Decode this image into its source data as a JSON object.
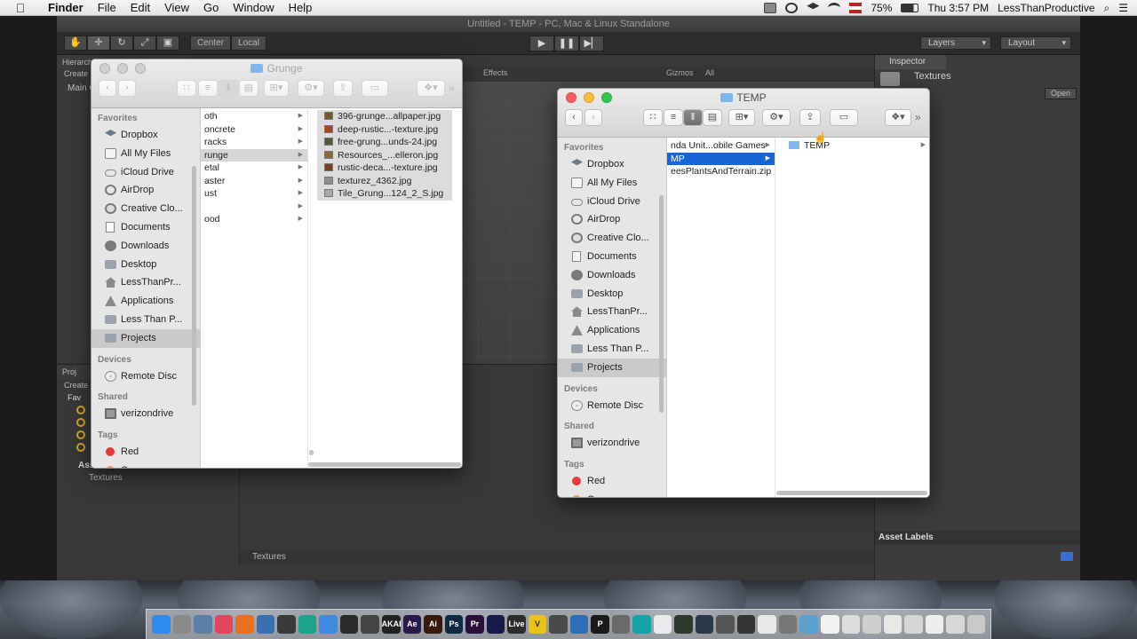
{
  "menubar": {
    "apple": "",
    "items": [
      "Finder",
      "File",
      "Edit",
      "View",
      "Go",
      "Window",
      "Help"
    ],
    "battery": "75%",
    "clock": "Thu 3:57 PM",
    "user": "LessThanProductive"
  },
  "unity": {
    "title": "Untitled - TEMP - PC, Mac & Linux Standalone",
    "pivot": "Center",
    "space": "Local",
    "layers": "Layers",
    "layout": "Layout",
    "hierarchy_tab": "Hierarchy",
    "hierarchy_create": "Create",
    "main_camera": "Main C",
    "effects": "Effects",
    "gizmos": "Gizmos",
    "gizmo_search": "All",
    "project_tab": "Proj",
    "project_create": "Create",
    "favorites_label": "Fav",
    "assets_label": "Ass",
    "textures_folder": "Textures",
    "footer_path": "Textures",
    "inspector_tab": "Inspector",
    "inspector_name": "Textures",
    "open_button": "Open",
    "asset_labels": "Asset Labels"
  },
  "finder_grunge": {
    "title": "Grunge",
    "column1": [
      {
        "label": "oth",
        "folder": true
      },
      {
        "label": "oncrete",
        "folder": true
      },
      {
        "label": "racks",
        "folder": true
      },
      {
        "label": "runge",
        "folder": true,
        "selected": true
      },
      {
        "label": "etal",
        "folder": true
      },
      {
        "label": "aster",
        "folder": true
      },
      {
        "label": "ust",
        "folder": true
      },
      {
        "label": "",
        "folder": true
      },
      {
        "label": "ood",
        "folder": true
      }
    ],
    "column2": [
      {
        "label": "396-grunge...allpaper.jpg",
        "color": "#6f5a28"
      },
      {
        "label": "deep-rustic...-texture.jpg",
        "color": "#a6471c"
      },
      {
        "label": "free-grung...unds-24.jpg",
        "color": "#4f5d3a"
      },
      {
        "label": "Resources_...elleron.jpg",
        "color": "#8a6a3c"
      },
      {
        "label": "rustic-deca...-texture.jpg",
        "color": "#7a3f1c"
      },
      {
        "label": "texturez_4362.jpg",
        "color": "#8d8d8d"
      },
      {
        "label": "Tile_Grung...124_2_S.jpg",
        "color": "#a8a8a8"
      }
    ]
  },
  "finder_temp": {
    "title": "TEMP",
    "column1": [
      {
        "label": "nda Unit...obile Games",
        "arrow": true
      },
      {
        "label": "MP",
        "arrow": true,
        "selected": true
      },
      {
        "label": "eesPlantsAndTerrain.zip",
        "arrow": false
      }
    ],
    "column2": [
      {
        "label": "TEMP",
        "arrow": true
      }
    ]
  },
  "sidebar": {
    "favorites_header": "Favorites",
    "favorites": [
      {
        "label": "Dropbox",
        "icon": "dropbox-icon"
      },
      {
        "label": "All My Files",
        "icon": "all-files-icon"
      },
      {
        "label": "iCloud Drive",
        "icon": "cloud-icon"
      },
      {
        "label": "AirDrop",
        "icon": "airdrop-icon"
      },
      {
        "label": "Creative Clo...",
        "icon": "creative-cloud-icon"
      },
      {
        "label": "Documents",
        "icon": "documents-icon"
      },
      {
        "label": "Downloads",
        "icon": "downloads-icon"
      },
      {
        "label": "Desktop",
        "icon": "desktop-icon"
      },
      {
        "label": "LessThanPr...",
        "icon": "home-icon"
      },
      {
        "label": "Applications",
        "icon": "applications-icon"
      },
      {
        "label": "Less Than P...",
        "icon": "folder-icon"
      },
      {
        "label": "Projects",
        "icon": "folder-icon",
        "selected": true
      }
    ],
    "devices_header": "Devices",
    "devices": [
      {
        "label": "Remote Disc",
        "icon": "disc-icon"
      }
    ],
    "shared_header": "Shared",
    "shared": [
      {
        "label": "verizondrive",
        "icon": "monitor-icon"
      }
    ],
    "tags_header": "Tags",
    "tags": [
      {
        "label": "Red",
        "color": "#e5393b"
      },
      {
        "label": "Orange",
        "color": "#f19735"
      }
    ]
  },
  "dock": {
    "icons": [
      {
        "name": "finder-icon",
        "label": "",
        "color": "#2d8cf0"
      },
      {
        "name": "system-prefs-icon",
        "label": "",
        "color": "#8a8a8a"
      },
      {
        "name": "preview-icon",
        "label": "",
        "color": "#5b7fa8"
      },
      {
        "name": "itunes-icon",
        "label": "",
        "color": "#e0465c"
      },
      {
        "name": "firefox-icon",
        "label": "",
        "color": "#e8711f"
      },
      {
        "name": "quicktime-icon",
        "label": "",
        "color": "#3a6fb0"
      },
      {
        "name": "terminal-icon",
        "label": "",
        "color": "#3a3a3a"
      },
      {
        "name": "app-teal-icon",
        "label": "",
        "color": "#1aa58a"
      },
      {
        "name": "chrome-icon",
        "label": "",
        "color": "#3f8ae0"
      },
      {
        "name": "unity-icon",
        "label": "",
        "color": "#2a2a2a"
      },
      {
        "name": "unity-hub-icon",
        "label": "",
        "color": "#444"
      },
      {
        "name": "akai-icon",
        "label": "AKAI",
        "color": "#222"
      },
      {
        "name": "after-effects-icon",
        "label": "Ae",
        "color": "#2a1a4a"
      },
      {
        "name": "illustrator-icon",
        "label": "Ai",
        "color": "#3a1a06"
      },
      {
        "name": "photoshop-icon",
        "label": "Ps",
        "color": "#0f2a45"
      },
      {
        "name": "premiere-icon",
        "label": "Pr",
        "color": "#2a0f3a"
      },
      {
        "name": "media-encoder-icon",
        "label": "",
        "color": "#1a1a4a"
      },
      {
        "name": "live-icon",
        "label": "Live",
        "color": "#2c2c2c"
      },
      {
        "name": "vectorize-icon",
        "label": "V",
        "color": "#e8c41a"
      },
      {
        "name": "audio-icon",
        "label": "",
        "color": "#4a4a4a"
      },
      {
        "name": "notes-icon",
        "label": "",
        "color": "#2b6fb5"
      },
      {
        "name": "pages-icon",
        "label": "P",
        "color": "#1a1a1a"
      },
      {
        "name": "app-gray-icon",
        "label": "",
        "color": "#6a6a6a"
      },
      {
        "name": "arduino-icon",
        "label": "",
        "color": "#16a3a8"
      },
      {
        "name": "textedit-icon",
        "label": "",
        "color": "#eaeaea"
      },
      {
        "name": "activity-icon",
        "label": "",
        "color": "#2c3a2c"
      },
      {
        "name": "monitor-app-icon",
        "label": "",
        "color": "#2a3a4a"
      },
      {
        "name": "app-dark-icon",
        "label": "",
        "color": "#555"
      },
      {
        "name": "github-icon",
        "label": "",
        "color": "#333"
      },
      {
        "name": "piano-icon",
        "label": "",
        "color": "#e8e8e8"
      },
      {
        "name": "app-box-icon",
        "label": "",
        "color": "#777"
      },
      {
        "name": "preview2-icon",
        "label": "",
        "color": "#5aa0d0"
      },
      {
        "name": "doc1-icon",
        "label": "",
        "color": "#f2f2f2"
      },
      {
        "name": "doc2-icon",
        "label": "",
        "color": "#dcdcdc"
      },
      {
        "name": "doc3-icon",
        "label": "",
        "color": "#cfcfcf"
      },
      {
        "name": "doc4-icon",
        "label": "",
        "color": "#e8e8e8"
      },
      {
        "name": "doc5-icon",
        "label": "",
        "color": "#d5d5d5"
      },
      {
        "name": "doc6-icon",
        "label": "",
        "color": "#eeeeee"
      },
      {
        "name": "doc7-icon",
        "label": "",
        "color": "#d8d8d8"
      },
      {
        "name": "trash-icon",
        "label": "",
        "color": "#c9c9c9"
      }
    ]
  }
}
